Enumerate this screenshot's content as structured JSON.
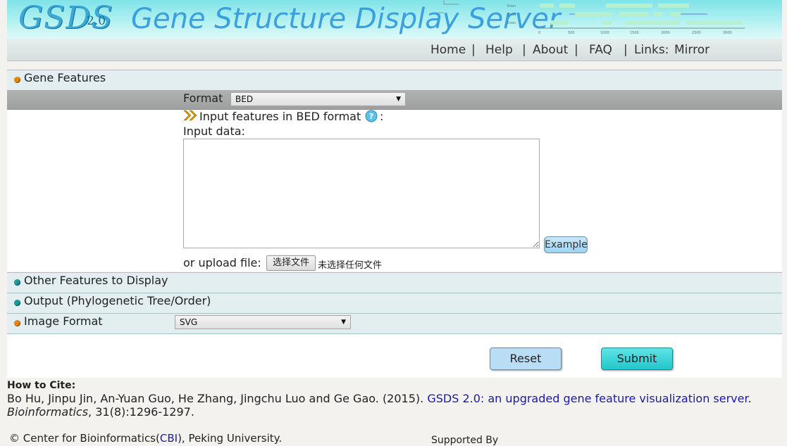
{
  "header": {
    "logo": "GSDS",
    "logo_version": "2.0",
    "title": "Gene Structure Display Server"
  },
  "nav": {
    "home": "Home",
    "help": "Help",
    "about": "About",
    "faq": "FAQ",
    "links_label": "Links:",
    "mirror": "Mirror"
  },
  "sections": {
    "gene_features": "Gene Features",
    "other_features": "Other Features to Display",
    "output": "Output (Phylogenetic Tree/Order)",
    "image_format": "Image Format"
  },
  "form": {
    "format_label": "Format",
    "format_value": "BED",
    "input_hint_prefix": "Input features in BED format",
    "input_hint_suffix": ":",
    "input_data_label": "Input data:",
    "textarea_value": "",
    "example_button": "Example",
    "upload_label": "or upload file:",
    "choose_file_button": "选择文件",
    "no_file_text": "未选择任何文件",
    "image_format_value": "SVG"
  },
  "actions": {
    "reset": "Reset",
    "submit": "Submit"
  },
  "citation": {
    "heading": "How to Cite:",
    "authors": "Bo Hu, Jinpu Jin, An-Yuan Guo, He Zhang, Jingchu Luo and Ge Gao. (2015).",
    "title_link": "GSDS 2.0: an upgraded gene feature visualization server",
    "title_end": ".",
    "journal": "Bioinformatics",
    "volume": ", 31(8):1296-1297."
  },
  "footer": {
    "copyright_prefix": "© Center for Bioinformatics(",
    "cbi_link": "CBI",
    "copyright_suffix": "), Peking University.",
    "supported_by": "Supported By"
  },
  "colors": {
    "accent": "#3aa0e0",
    "section_bg": "#e2eef0",
    "link": "#1a1aa6"
  },
  "icons": {
    "section_open": "orange-dot-icon",
    "section_closed": "teal-dot-icon",
    "hint": "double-chevron-icon",
    "help": "question-icon"
  }
}
